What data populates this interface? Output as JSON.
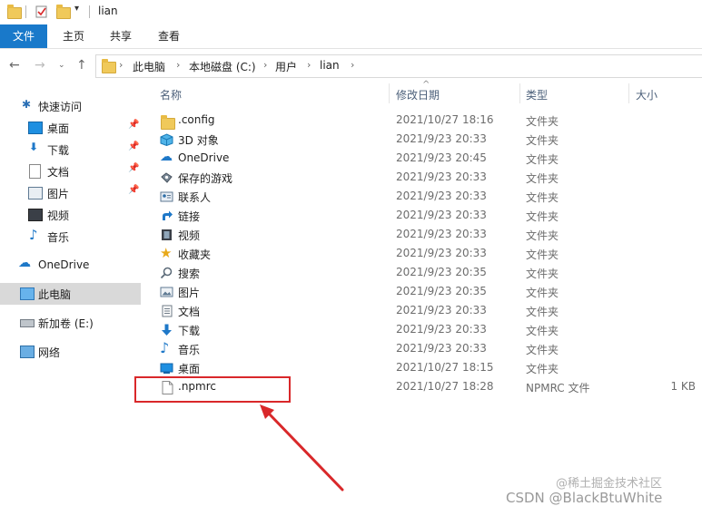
{
  "window": {
    "title": "lian"
  },
  "ribbon": {
    "tabs": [
      "文件",
      "主页",
      "共享",
      "查看"
    ]
  },
  "address": {
    "crumbs": [
      "此电脑",
      "本地磁盘 (C:)",
      "用户",
      "lian"
    ]
  },
  "nav": {
    "quick_access": "快速访问",
    "items": [
      "桌面",
      "下载",
      "文档",
      "图片",
      "视频",
      "音乐"
    ],
    "onedrive": "OneDrive",
    "this_pc": "此电脑",
    "new_volume": "新加卷 (E:)",
    "network": "网络"
  },
  "columns": {
    "name": "名称",
    "date": "修改日期",
    "type": "类型",
    "size": "大小"
  },
  "files": [
    {
      "name": ".config",
      "date": "2021/10/27 18:16",
      "type": "文件夹",
      "size": "",
      "icon": "folder-icon"
    },
    {
      "name": "3D 对象",
      "date": "2021/9/23 20:33",
      "type": "文件夹",
      "size": "",
      "icon": "3d-objects-icon"
    },
    {
      "name": "OneDrive",
      "date": "2021/9/23 20:45",
      "type": "文件夹",
      "size": "",
      "icon": "cloud-icon"
    },
    {
      "name": "保存的游戏",
      "date": "2021/9/23 20:33",
      "type": "文件夹",
      "size": "",
      "icon": "saved-games-icon"
    },
    {
      "name": "联系人",
      "date": "2021/9/23 20:33",
      "type": "文件夹",
      "size": "",
      "icon": "contacts-icon"
    },
    {
      "name": "链接",
      "date": "2021/9/23 20:33",
      "type": "文件夹",
      "size": "",
      "icon": "links-icon"
    },
    {
      "name": "视频",
      "date": "2021/9/23 20:33",
      "type": "文件夹",
      "size": "",
      "icon": "video-icon"
    },
    {
      "name": "收藏夹",
      "date": "2021/9/23 20:33",
      "type": "文件夹",
      "size": "",
      "icon": "star-icon"
    },
    {
      "name": "搜索",
      "date": "2021/9/23 20:35",
      "type": "文件夹",
      "size": "",
      "icon": "search-icon"
    },
    {
      "name": "图片",
      "date": "2021/9/23 20:35",
      "type": "文件夹",
      "size": "",
      "icon": "pictures-icon"
    },
    {
      "name": "文档",
      "date": "2021/9/23 20:33",
      "type": "文件夹",
      "size": "",
      "icon": "documents-icon"
    },
    {
      "name": "下载",
      "date": "2021/9/23 20:33",
      "type": "文件夹",
      "size": "",
      "icon": "download-icon"
    },
    {
      "name": "音乐",
      "date": "2021/9/23 20:33",
      "type": "文件夹",
      "size": "",
      "icon": "music-icon"
    },
    {
      "name": "桌面",
      "date": "2021/10/27 18:15",
      "type": "文件夹",
      "size": "",
      "icon": "desktop-icon"
    },
    {
      "name": ".npmrc",
      "date": "2021/10/27 18:28",
      "type": "NPMRC 文件",
      "size": "1 KB",
      "icon": "file-icon"
    }
  ],
  "watermark": {
    "main": "CSDN @BlackBtuWhite",
    "sub": "@稀土掘金技术社区"
  },
  "colors": {
    "accent": "#1979ca",
    "highlight": "#d9282a",
    "folder": "#f0c95a"
  }
}
